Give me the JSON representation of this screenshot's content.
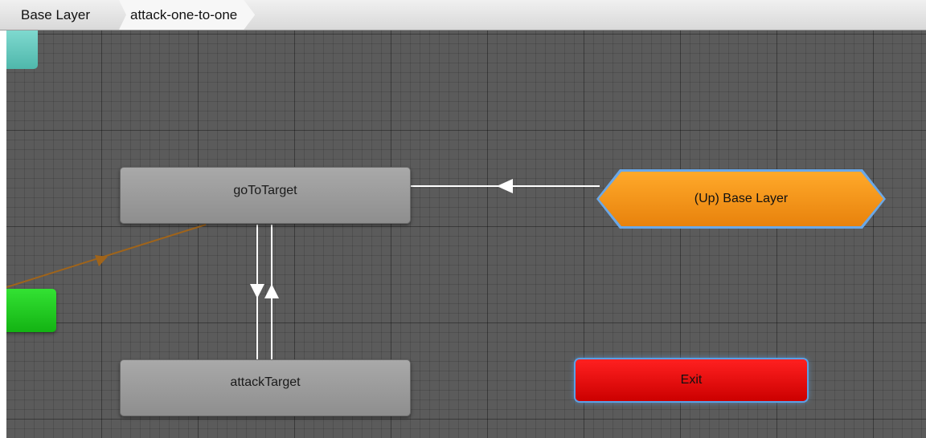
{
  "breadcrumb": {
    "items": [
      {
        "label": "Base Layer"
      },
      {
        "label": "attack-one-to-one"
      }
    ]
  },
  "states": {
    "go_to_target": {
      "label": "goToTarget"
    },
    "attack_target": {
      "label": "attackTarget"
    },
    "up_base_layer": {
      "label": "(Up) Base Layer"
    },
    "exit": {
      "label": "Exit"
    }
  },
  "colors": {
    "graph_background": "#5b5b5b",
    "state_node": "#9e9e9e",
    "up_node": "#f7960f",
    "exit_node": "#e00000",
    "entry_node": "#22cc22",
    "any_state_node": "#66c8bd",
    "selection_glow": "#5aa0e6",
    "transition_default": "#ffffff",
    "transition_entry": "#a0641a"
  }
}
